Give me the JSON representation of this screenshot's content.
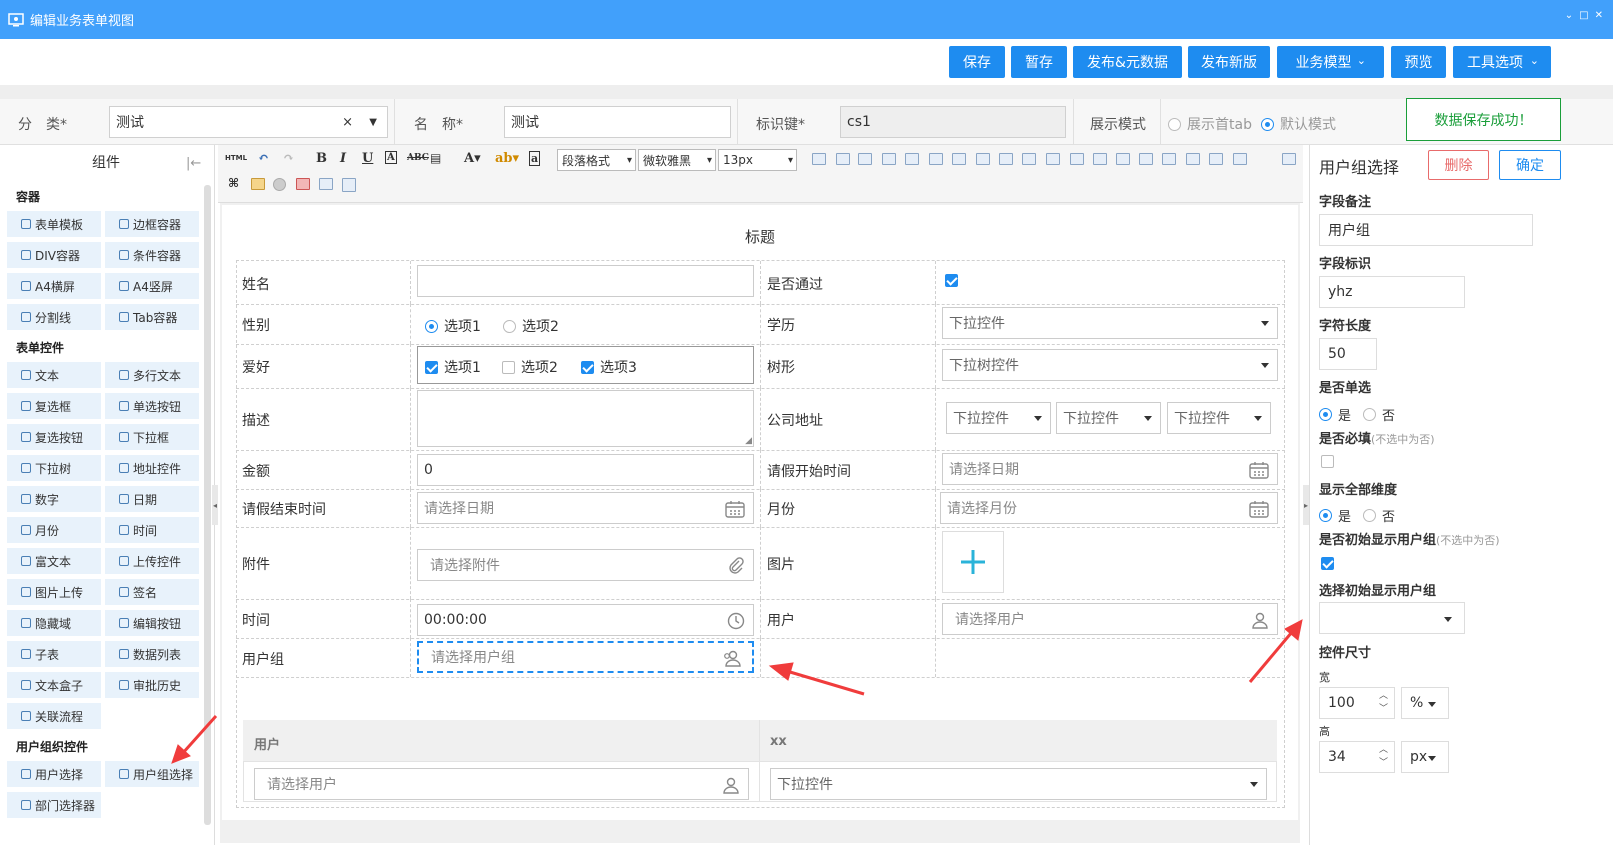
{
  "window": {
    "title": "编辑业务表单视图"
  },
  "toolbar_buttons": [
    "保存",
    "暂存",
    "发布&元数据",
    "发布新版",
    "业务模型",
    "预览",
    "工具选项"
  ],
  "meta": {
    "category_label": "分　类*",
    "category_value": "测试",
    "name_label": "名　称*",
    "name_value": "测试",
    "key_label": "标识键*",
    "key_value": "cs1",
    "display_mode_label": "展示模式",
    "mode_option1": "展示首tab",
    "mode_option2": "默认模式",
    "success_msg": "数据保存成功！"
  },
  "left_panel": {
    "title": "组件",
    "sections": [
      {
        "name": "容器",
        "items": [
          "表单模板",
          "边框容器",
          "DIV容器",
          "条件容器",
          "A4横屏",
          "A4竖屏",
          "分割线",
          "Tab容器"
        ]
      },
      {
        "name": "表单控件",
        "items": [
          "文本",
          "多行文本",
          "复选框",
          "单选按钮",
          "复选按钮",
          "下拉框",
          "下拉树",
          "地址控件",
          "数字",
          "日期",
          "月份",
          "时间",
          "富文本",
          "上传控件",
          "图片上传",
          "签名",
          "隐藏域",
          "编辑按钮",
          "子表",
          "数据列表",
          "文本盒子",
          "审批历史",
          "关联流程"
        ]
      },
      {
        "name": "用户组织控件",
        "items": [
          "用户选择",
          "用户组选择",
          "部门选择器"
        ]
      }
    ]
  },
  "editor_toolbar": {
    "paragraph": "段落格式",
    "font": "微软雅黑",
    "size": "13px",
    "html_label": "HTML"
  },
  "form": {
    "title": "标题",
    "rows": [
      {
        "left_label": "姓名",
        "right_label": "是否通过"
      },
      {
        "left_label": "性别",
        "right_label": "学历"
      },
      {
        "left_label": "爱好",
        "right_label": "树形"
      },
      {
        "left_label": "描述",
        "right_label": "公司地址"
      },
      {
        "left_label": "金额",
        "right_label": "请假开始时间"
      },
      {
        "left_label": "请假结束时间",
        "right_label": "月份"
      },
      {
        "left_label": "附件",
        "right_label": "图片"
      },
      {
        "left_label": "时间",
        "right_label": "用户"
      },
      {
        "left_label": "用户组",
        "right_label": ""
      }
    ],
    "gender_options": [
      "选项1",
      "选项2"
    ],
    "hobby_options": [
      "选项1",
      "选项2",
      "选项3"
    ],
    "edu_dropdown": "下拉控件",
    "tree_dropdown": "下拉树控件",
    "address_dropdowns": [
      "下拉控件",
      "下拉控件",
      "下拉控件"
    ],
    "amount_value": "0",
    "start_date_placeholder": "请选择日期",
    "end_date_placeholder": "请选择日期",
    "month_placeholder": "请选择月份",
    "attach_placeholder": "请选择附件",
    "time_value": "00:00:00",
    "user_placeholder": "请选择用户",
    "usergroup_placeholder": "请选择用户组",
    "subtable": {
      "headers": [
        "用户",
        "xx"
      ],
      "user_placeholder": "请选择用户",
      "dropdown": "下拉控件"
    }
  },
  "right_panel": {
    "title": "用户组选择",
    "delete_btn": "删除",
    "confirm_btn": "确定",
    "field_note_label": "字段备注",
    "field_note_value": "用户组",
    "field_key_label": "字段标识",
    "field_key_value": "yhz",
    "char_len_label": "字符长度",
    "char_len_value": "50",
    "single_label": "是否单选",
    "yes": "是",
    "no": "否",
    "required_label": "是否必填",
    "required_hint": "(不选中为否)",
    "show_all_label": "显示全部维度",
    "init_show_label": "是否初始显示用户组",
    "init_show_hint": "(不选中为否)",
    "select_init_label": "选择初始显示用户组",
    "size_label": "控件尺寸",
    "width_label": "宽",
    "width_value": "100",
    "width_unit": "%",
    "height_label": "高",
    "height_value": "34",
    "height_unit": "px"
  },
  "colors": {
    "titlebar": "#41a0fb",
    "button": "#1e8cf0",
    "success": "#1a9e3a",
    "arrow": "#f03c3c"
  }
}
